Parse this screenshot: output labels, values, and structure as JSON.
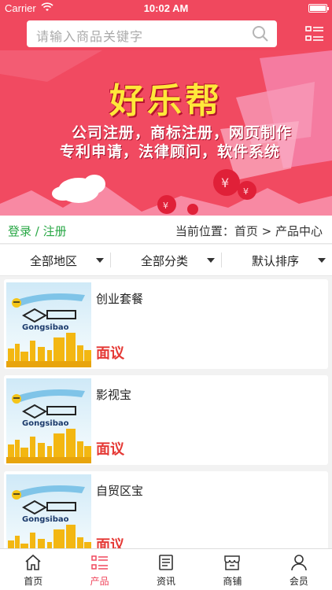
{
  "status": {
    "carrier": "Carrier",
    "time": "10:02 AM"
  },
  "search": {
    "placeholder": "请输入商品关键字"
  },
  "banner": {
    "title": "好乐帮",
    "line1": "公司注册，商标注册，网页制作",
    "line2": "专利申请，法律顾问，软件系统"
  },
  "crumbs": {
    "login": "登录 / 注册",
    "location": "当前位置：首页 > 产品中心"
  },
  "filters": [
    {
      "label": "全部地区"
    },
    {
      "label": "全部分类"
    },
    {
      "label": "默认排序"
    }
  ],
  "products": [
    {
      "name": "创业套餐",
      "price": "面议"
    },
    {
      "name": "影视宝",
      "price": "面议"
    },
    {
      "name": "自贸区宝",
      "price": "面议"
    }
  ],
  "thumb_brand": "Gongsibao",
  "tabs": [
    {
      "label": "首页",
      "icon": "home-icon"
    },
    {
      "label": "产品",
      "icon": "list-icon"
    },
    {
      "label": "资讯",
      "icon": "news-icon"
    },
    {
      "label": "商铺",
      "icon": "store-icon"
    },
    {
      "label": "会员",
      "icon": "user-icon"
    }
  ],
  "colors": {
    "primary": "#f0485e",
    "price": "#e53935",
    "login": "#28a745"
  }
}
